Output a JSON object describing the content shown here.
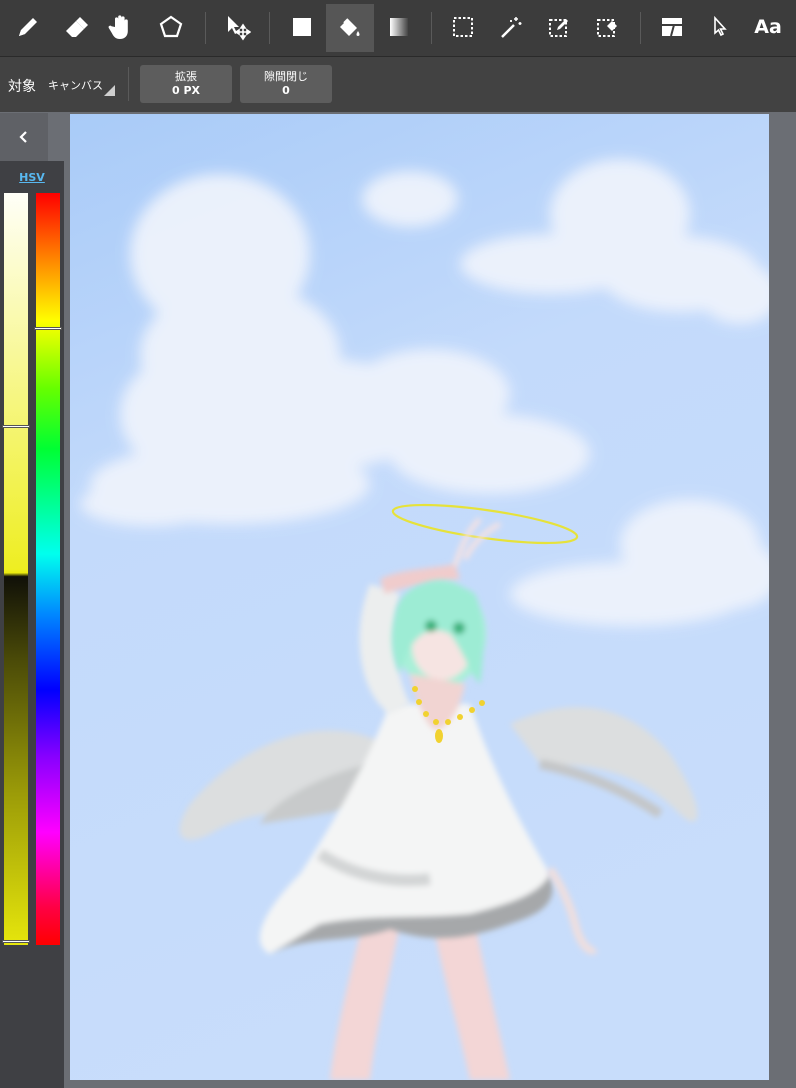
{
  "toolbar": {
    "tools": [
      {
        "name": "pen-icon"
      },
      {
        "name": "eraser-icon"
      },
      {
        "name": "hand-icon"
      },
      {
        "name": "lasso-polygon-icon"
      },
      {
        "name": "move-icon"
      },
      {
        "name": "fill-rect-icon"
      },
      {
        "name": "bucket-icon",
        "active": true
      },
      {
        "name": "gradient-icon"
      },
      {
        "name": "rect-select-icon"
      },
      {
        "name": "magic-wand-icon"
      },
      {
        "name": "select-pen-icon"
      },
      {
        "name": "select-eraser-icon"
      },
      {
        "name": "frame-divide-icon"
      },
      {
        "name": "pointer-icon"
      }
    ],
    "text_tool_label": "Aa"
  },
  "options": {
    "target_label": "対象",
    "target_value": "キャンバス",
    "expand": {
      "label": "拡張",
      "value": "0 PX"
    },
    "gap_close": {
      "label": "隙間閉じ",
      "value": "0"
    }
  },
  "color_panel": {
    "mode_label": "HSV",
    "sv_position": 0.31,
    "hue_position": 0.18,
    "brightness_position": 0.996
  },
  "colors": {
    "accent": "#58b8f0",
    "toolbar_bg": "#3c3c3c",
    "canvas_sky": "#c6dcfb"
  }
}
